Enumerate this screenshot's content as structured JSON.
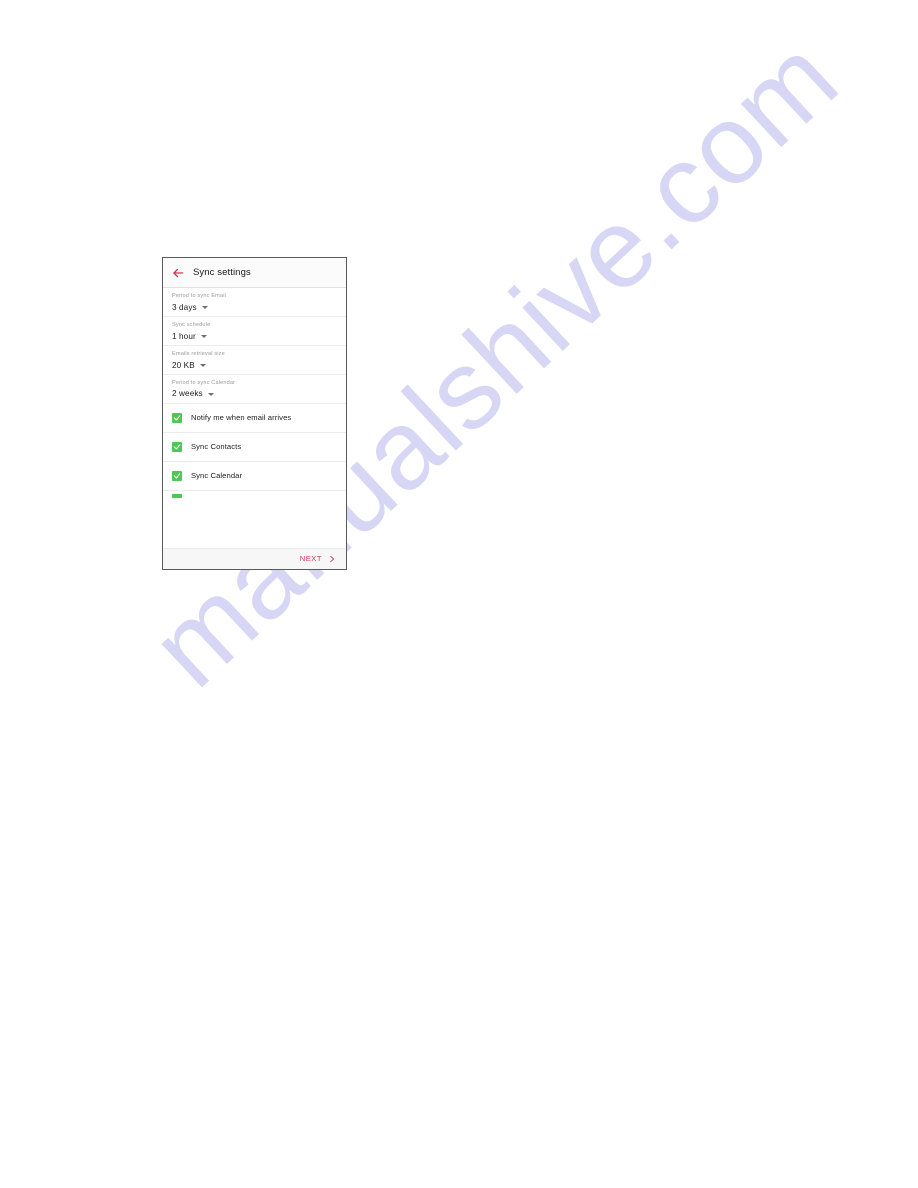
{
  "page": {
    "background_color": "#ffffff",
    "watermark_text": "manualshive.com",
    "watermark_color": "#c9c9f2"
  },
  "device": {
    "appbar": {
      "back_icon": "arrow-left-icon",
      "back_icon_color": "#d4364a",
      "title": "Sync settings"
    },
    "settings": {
      "selects": [
        {
          "label": "Period to sync Email",
          "value": "3 days",
          "caret_icon": "chevron-down-icon"
        },
        {
          "label": "Sync schedule",
          "value": "1 hour",
          "caret_icon": "chevron-down-icon"
        },
        {
          "label": "Emails retrieval size",
          "value": "20 KB",
          "caret_icon": "chevron-down-icon"
        },
        {
          "label": "Period to sync Calendar",
          "value": "2 weeks",
          "caret_icon": "chevron-down-icon"
        }
      ],
      "checkboxes": [
        {
          "label": "Notify me when email arrives",
          "checked": true,
          "icon": "checkbox-checked-icon"
        },
        {
          "label": "Sync Contacts",
          "checked": true,
          "icon": "checkbox-checked-icon"
        },
        {
          "label": "Sync Calendar",
          "checked": true,
          "icon": "checkbox-checked-icon"
        }
      ],
      "checkbox_color": "#4cc955",
      "partial_row": {
        "label": "",
        "checked": true,
        "icon": "checkbox-checked-icon"
      }
    },
    "footer": {
      "next_label": "NEXT",
      "next_icon": "chevron-right-icon",
      "next_color": "#d83a4d"
    }
  }
}
